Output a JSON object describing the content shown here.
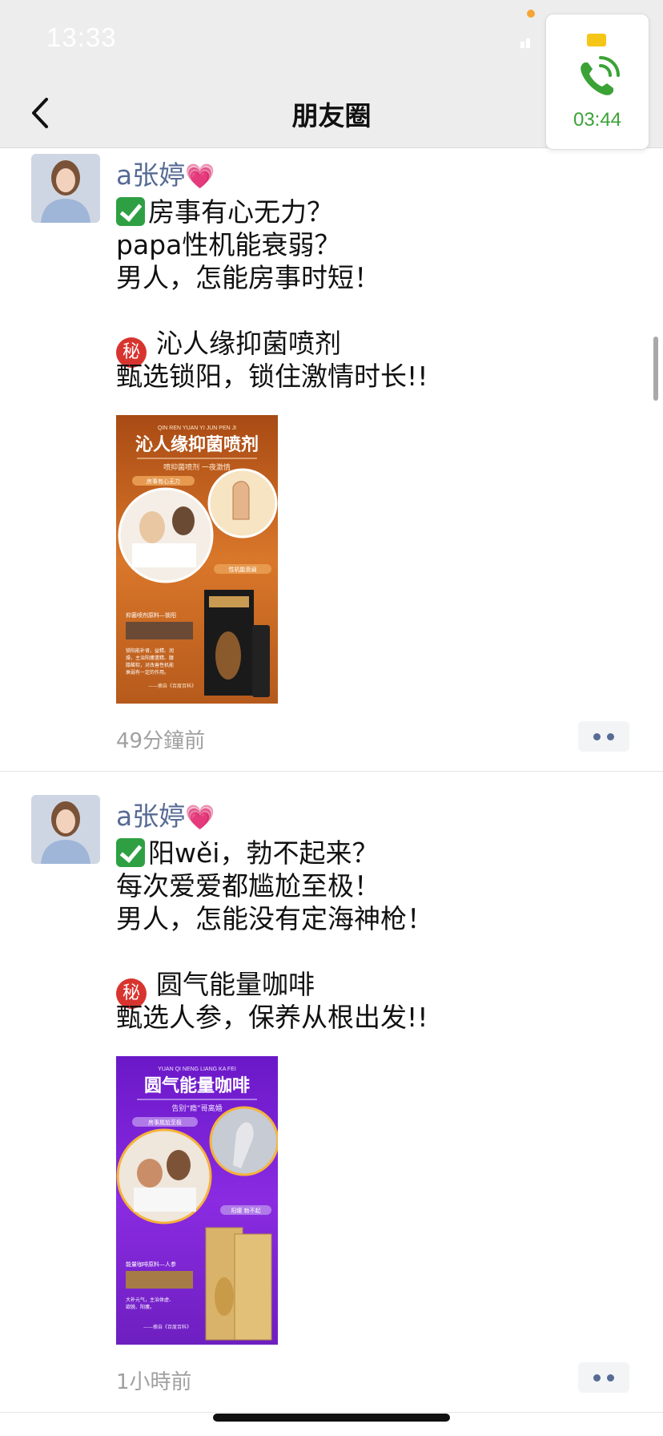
{
  "status_bar": {
    "time": "13:33"
  },
  "header": {
    "title": "朋友圈"
  },
  "call_widget": {
    "timer": "03:44"
  },
  "posts": [
    {
      "author": "a张婷",
      "author_emoji": "💗",
      "lines": [
        "房事有心无力？",
        "papa性机能衰弱？",
        "男人，怎能房事时短！",
        "",
        "沁人缘抑菌喷剂",
        "甄选锁阳，锁住激情时长!!"
      ],
      "image": {
        "pinyin": "QIN REN YUAN YI JUN PEN JI",
        "headline": "沁人缘抑菌喷剂",
        "tagline": "喷抑菌喷剂 一夜激情",
        "tag_a": "房事有心无力",
        "tag_b": "性机能衰弱",
        "caption_title": "抑菌喷剂原料—锁阳",
        "caption_text": "锁阳能补肾、益精、润燥，主治阳痿遗精、腰膝酸软，对改善性机能衰弱有一定的作用。",
        "caption_source": "——摘自《百度百科》"
      },
      "time": "49分鐘前"
    },
    {
      "author": "a张婷",
      "author_emoji": "💗",
      "lines": [
        "阳wěi，勃不起来？",
        "每次爱爱都尴尬至极！",
        "男人，怎能没有定海神枪！",
        "",
        "圆气能量咖啡",
        "甄选人参，保养从根出发!!"
      ],
      "image": {
        "pinyin": "YUAN QI NENG LIANG KA FEI",
        "headline": "圆气能量咖啡",
        "tagline": "告别“瘾”哥离婚",
        "tag_a": "房事尴尬至极",
        "tag_b": "阳痿 勃不起",
        "caption_title": "能量咖啡原料—人参",
        "caption_text": "大补元气，主治体虚、欲脱、阳痿。",
        "caption_source": "——摘自《百度百科》"
      },
      "time": "1小時前"
    }
  ],
  "colors": {
    "name": "#576b95",
    "call_green": "#3ba236",
    "image1_bg": "#c8621e",
    "image2_bg": "#7a1fd6"
  }
}
